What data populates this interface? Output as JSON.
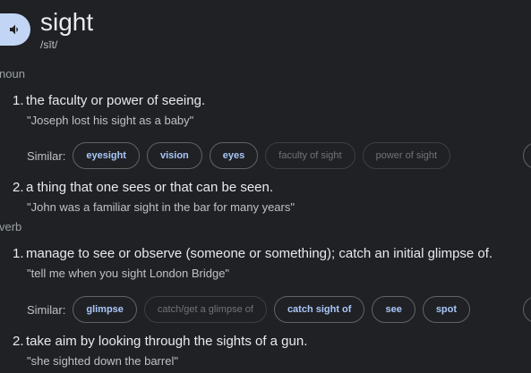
{
  "entry": {
    "word": "sight",
    "phonetic": "/sīt/",
    "speaker_icon": "speaker-icon"
  },
  "noun": {
    "pos_label": "noun",
    "definitions": [
      {
        "number": "1.",
        "text": "the faculty or power of seeing.",
        "example": "\"Joseph lost his sight as a baby\"",
        "similar_label": "Similar:",
        "similar": [
          {
            "label": "eyesight",
            "active": true
          },
          {
            "label": "vision",
            "active": true
          },
          {
            "label": "eyes",
            "active": true
          },
          {
            "label": "faculty of sight",
            "active": false
          },
          {
            "label": "power of sight",
            "active": false
          }
        ]
      },
      {
        "number": "2.",
        "text": "a thing that one sees or that can be seen.",
        "example": "\"John was a familiar sight in the bar for many years\""
      }
    ]
  },
  "verb": {
    "pos_label": "verb",
    "definitions": [
      {
        "number": "1.",
        "text": "manage to see or observe (someone or something); catch an initial glimpse of.",
        "example": "\"tell me when you sight London Bridge\"",
        "similar_label": "Similar:",
        "similar": [
          {
            "label": "glimpse",
            "active": true
          },
          {
            "label": "catch/get a glimpse of",
            "active": false
          },
          {
            "label": "catch sight of",
            "active": true
          },
          {
            "label": "see",
            "active": true
          },
          {
            "label": "spot",
            "active": true
          }
        ]
      },
      {
        "number": "2.",
        "text": "take aim by looking through the sights of a gun.",
        "example": "\"she sighted down the barrel\""
      }
    ]
  },
  "colors": {
    "background": "#202124",
    "text": "#e8eaed",
    "secondary_text": "#bdc1c6",
    "chip_text": "#a8c7fa",
    "chip_muted_text": "#6f7378",
    "speaker_bg": "#c2d5f4"
  }
}
